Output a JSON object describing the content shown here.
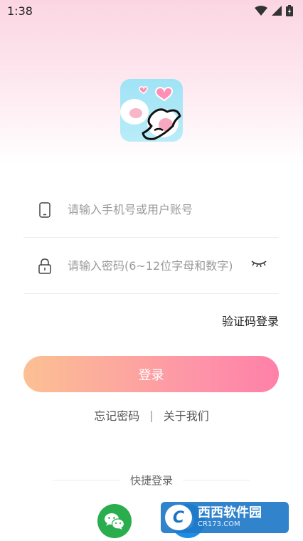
{
  "status_bar": {
    "time": "1:38"
  },
  "login": {
    "phone_placeholder": "请输入手机号或用户账号",
    "password_placeholder": "请输入密码(6~12位字母和数字)",
    "sms_login_label": "验证码登录",
    "login_button": "登录",
    "forgot_password": "忘记密码",
    "separator": "|",
    "about_us": "关于我们",
    "quick_login_label": "快捷登录"
  },
  "icons": {
    "phone": "smartphone-icon",
    "lock": "lock-icon",
    "eye": "eye-closed-icon",
    "wechat": "wechat-icon",
    "qq": "qq-icon"
  },
  "watermark": {
    "main": "西西软件园",
    "sub": "CR173.COM"
  },
  "colors": {
    "button_start": "#fcc093",
    "button_end": "#ff80a8",
    "wechat": "#2aad4c",
    "qq": "#1d8ee6"
  }
}
